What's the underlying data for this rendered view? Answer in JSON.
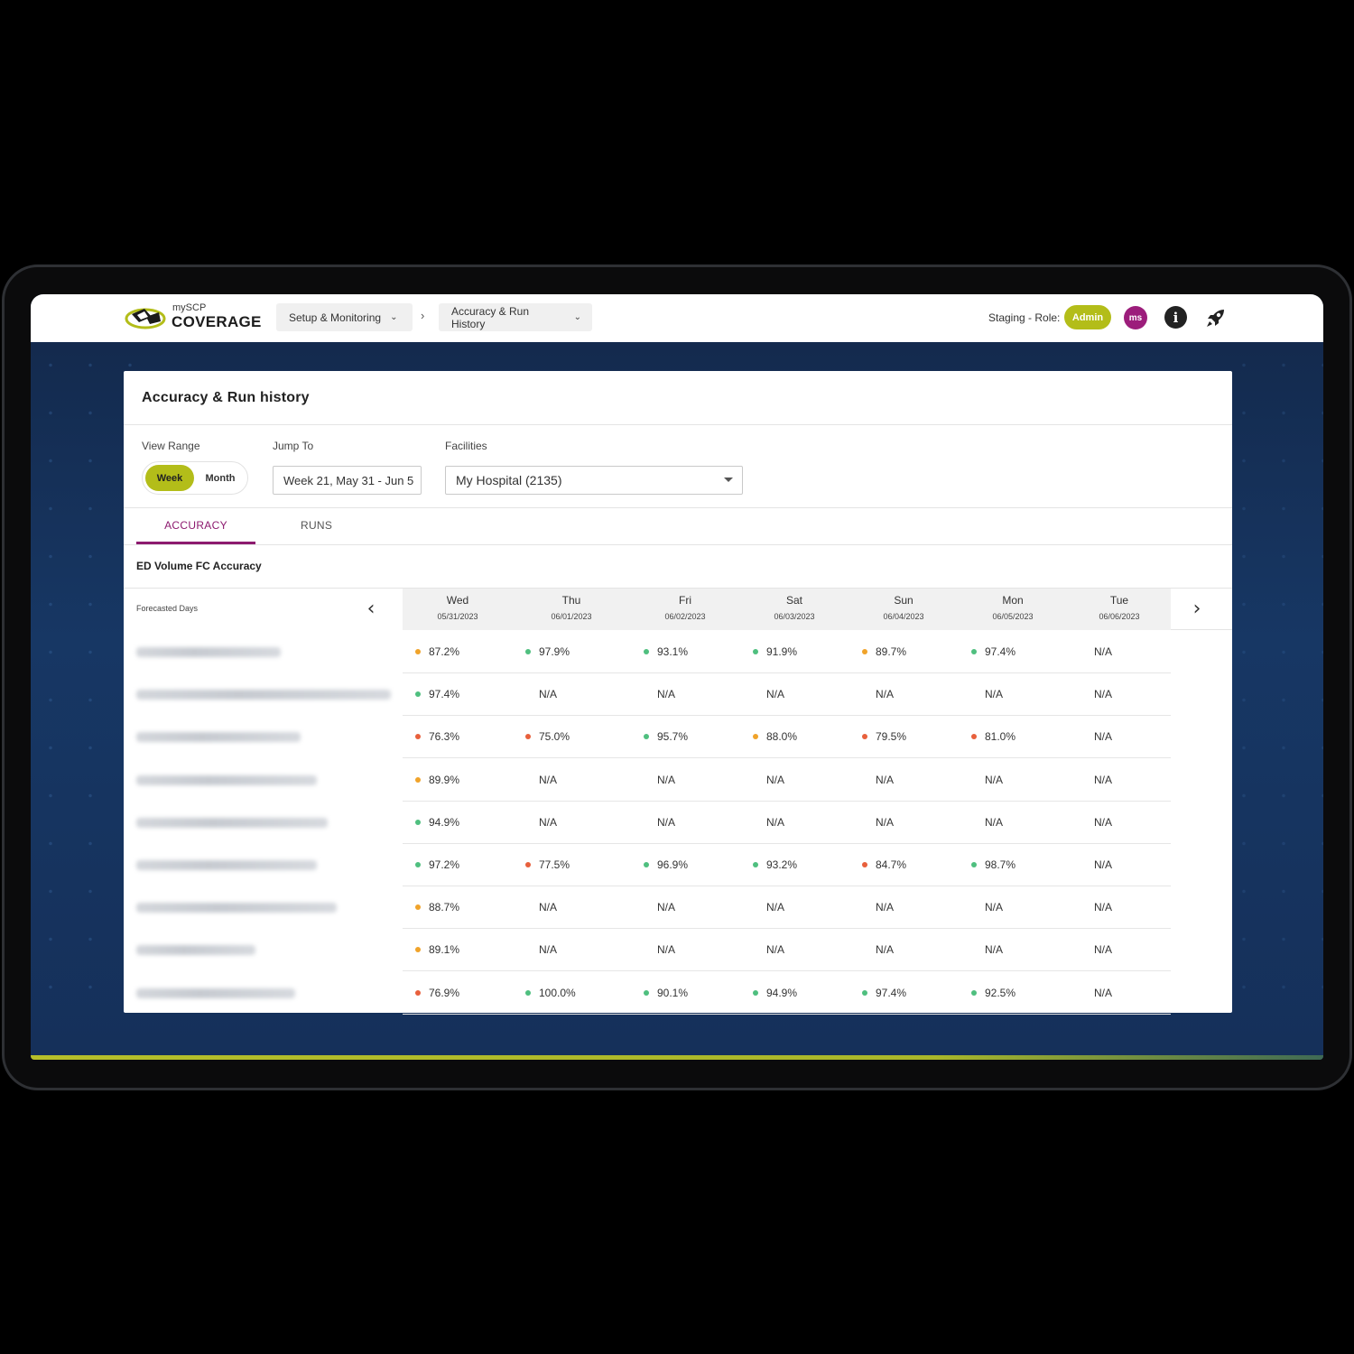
{
  "app": {
    "logo_small": "mySCP",
    "logo_big": "COVERAGE"
  },
  "breadcrumbs": [
    {
      "label": "Setup & Monitoring"
    },
    {
      "label": "Accuracy & Run History"
    }
  ],
  "breadcrumb_separator": "›",
  "header": {
    "env_role_label": "Staging - Role:",
    "role": "Admin",
    "avatar_initials": "ms"
  },
  "colors": {
    "accent_lime": "#b3bd19",
    "accent_purple": "#8d1a6f",
    "status_good": "#4fbf7f",
    "status_warn": "#f0a32a",
    "status_bad": "#e8603c"
  },
  "page": {
    "title": "Accuracy & Run history",
    "view_range_label": "View Range",
    "view_range_options": [
      "Week",
      "Month"
    ],
    "view_range_selected": "Week",
    "jump_to_label": "Jump To",
    "jump_to_value": "Week 21, May 31 - Jun 5",
    "facilities_label": "Facilities",
    "facilities_value": "My Hospital (2135)",
    "tabs": [
      "ACCURACY",
      "RUNS"
    ],
    "active_tab": "ACCURACY",
    "section_title": "ED Volume FC Accuracy"
  },
  "table": {
    "row_header_label": "Forecasted Days",
    "days": [
      {
        "name": "Wed",
        "date": "05/31/2023"
      },
      {
        "name": "Thu",
        "date": "06/01/2023"
      },
      {
        "name": "Fri",
        "date": "06/02/2023"
      },
      {
        "name": "Sat",
        "date": "06/03/2023"
      },
      {
        "name": "Sun",
        "date": "06/04/2023"
      },
      {
        "name": "Mon",
        "date": "06/05/2023"
      },
      {
        "name": "Tue",
        "date": "06/06/2023"
      }
    ],
    "rows": [
      {
        "cells": [
          {
            "v": "87.2%",
            "s": "warn"
          },
          {
            "v": "97.9%",
            "s": "good"
          },
          {
            "v": "93.1%",
            "s": "good"
          },
          {
            "v": "91.9%",
            "s": "good"
          },
          {
            "v": "89.7%",
            "s": "warn"
          },
          {
            "v": "97.4%",
            "s": "good"
          },
          {
            "v": "N/A",
            "s": ""
          }
        ]
      },
      {
        "cells": [
          {
            "v": "97.4%",
            "s": "good"
          },
          {
            "v": "N/A",
            "s": ""
          },
          {
            "v": "N/A",
            "s": ""
          },
          {
            "v": "N/A",
            "s": ""
          },
          {
            "v": "N/A",
            "s": ""
          },
          {
            "v": "N/A",
            "s": ""
          },
          {
            "v": "N/A",
            "s": ""
          }
        ]
      },
      {
        "cells": [
          {
            "v": "76.3%",
            "s": "bad"
          },
          {
            "v": "75.0%",
            "s": "bad"
          },
          {
            "v": "95.7%",
            "s": "good"
          },
          {
            "v": "88.0%",
            "s": "warn"
          },
          {
            "v": "79.5%",
            "s": "bad"
          },
          {
            "v": "81.0%",
            "s": "bad"
          },
          {
            "v": "N/A",
            "s": ""
          }
        ]
      },
      {
        "cells": [
          {
            "v": "89.9%",
            "s": "warn"
          },
          {
            "v": "N/A",
            "s": ""
          },
          {
            "v": "N/A",
            "s": ""
          },
          {
            "v": "N/A",
            "s": ""
          },
          {
            "v": "N/A",
            "s": ""
          },
          {
            "v": "N/A",
            "s": ""
          },
          {
            "v": "N/A",
            "s": ""
          }
        ]
      },
      {
        "cells": [
          {
            "v": "94.9%",
            "s": "good"
          },
          {
            "v": "N/A",
            "s": ""
          },
          {
            "v": "N/A",
            "s": ""
          },
          {
            "v": "N/A",
            "s": ""
          },
          {
            "v": "N/A",
            "s": ""
          },
          {
            "v": "N/A",
            "s": ""
          },
          {
            "v": "N/A",
            "s": ""
          }
        ]
      },
      {
        "cells": [
          {
            "v": "97.2%",
            "s": "good"
          },
          {
            "v": "77.5%",
            "s": "bad"
          },
          {
            "v": "96.9%",
            "s": "good"
          },
          {
            "v": "93.2%",
            "s": "good"
          },
          {
            "v": "84.7%",
            "s": "bad"
          },
          {
            "v": "98.7%",
            "s": "good"
          },
          {
            "v": "N/A",
            "s": ""
          }
        ]
      },
      {
        "cells": [
          {
            "v": "88.7%",
            "s": "warn"
          },
          {
            "v": "N/A",
            "s": ""
          },
          {
            "v": "N/A",
            "s": ""
          },
          {
            "v": "N/A",
            "s": ""
          },
          {
            "v": "N/A",
            "s": ""
          },
          {
            "v": "N/A",
            "s": ""
          },
          {
            "v": "N/A",
            "s": ""
          }
        ]
      },
      {
        "cells": [
          {
            "v": "89.1%",
            "s": "warn"
          },
          {
            "v": "N/A",
            "s": ""
          },
          {
            "v": "N/A",
            "s": ""
          },
          {
            "v": "N/A",
            "s": ""
          },
          {
            "v": "N/A",
            "s": ""
          },
          {
            "v": "N/A",
            "s": ""
          },
          {
            "v": "N/A",
            "s": ""
          }
        ]
      },
      {
        "cells": [
          {
            "v": "76.9%",
            "s": "bad"
          },
          {
            "v": "100.0%",
            "s": "good"
          },
          {
            "v": "90.1%",
            "s": "good"
          },
          {
            "v": "94.9%",
            "s": "good"
          },
          {
            "v": "97.4%",
            "s": "good"
          },
          {
            "v": "92.5%",
            "s": "good"
          },
          {
            "v": "N/A",
            "s": ""
          }
        ]
      }
    ]
  },
  "icons": {
    "prev": "chevron-left-icon",
    "next": "chevron-right-icon",
    "info": "info-icon",
    "rocket": "rocket-icon",
    "dropdown": "caret-down-icon"
  }
}
